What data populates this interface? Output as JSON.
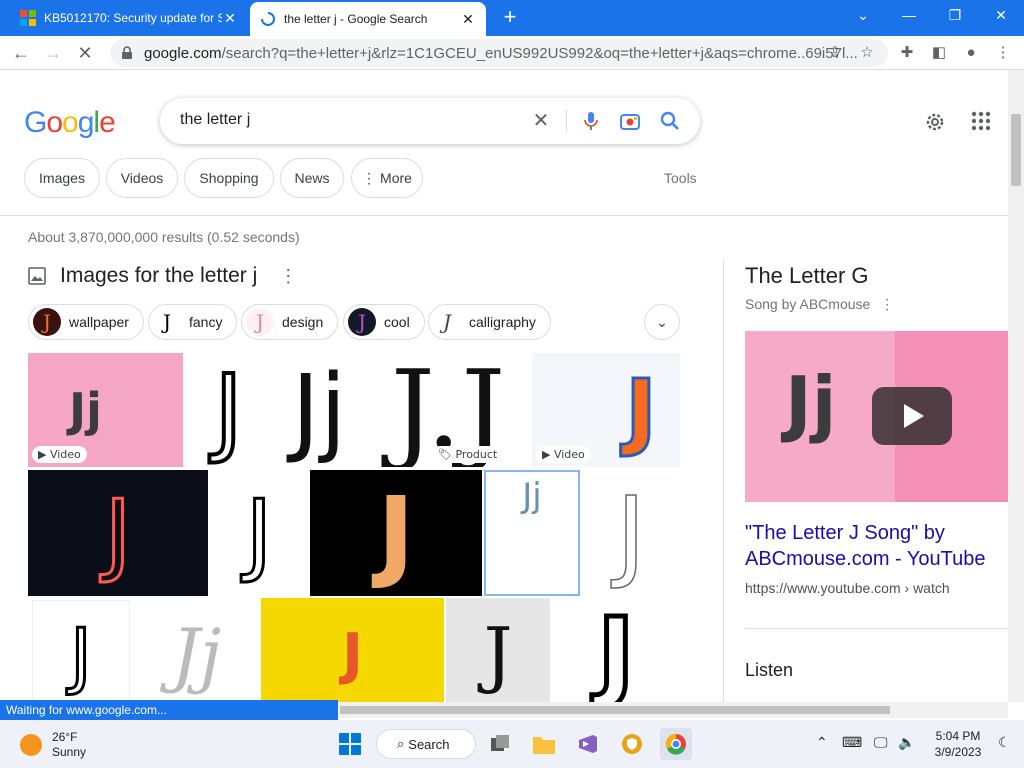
{
  "tabs": [
    {
      "title": "KB5012170: Security update for S",
      "close": "✕"
    },
    {
      "title": "the letter j - Google Search",
      "close": "✕"
    }
  ],
  "new_tab": "+",
  "window_controls": {
    "minimize": "—",
    "maximize": "❐",
    "close": "✕",
    "tabsearch": "⌄"
  },
  "address": {
    "domain": "google.com",
    "path": "/search?q=the+letter+j&rlz=1C1GCEU_enUS992US992&oq=the+letter+j&aqs=chrome..69i57l..."
  },
  "search": {
    "query": "the letter j"
  },
  "filters": [
    "Images",
    "Videos",
    "Shopping",
    "News",
    "More"
  ],
  "tools_label": "Tools",
  "results_stats": "About 3,870,000,000 results (0.52 seconds)",
  "images_section": {
    "title": "Images for the letter j",
    "pills": [
      "wallpaper",
      "fancy",
      "design",
      "cool",
      "calligraphy"
    ],
    "tags": {
      "video1": "Video",
      "product": "Product",
      "video2": "Video"
    }
  },
  "knowledge_panel": {
    "title": "The Letter G",
    "subtitle": "Song by ABCmouse",
    "link": "\"The Letter J Song\" by ABCmouse.com - YouTube",
    "url": "https://www.youtube.com › watch",
    "listen": "Listen"
  },
  "status_text": "Waiting for www.google.com...",
  "taskbar": {
    "weather_temp": "26°F",
    "weather_cond": "Sunny",
    "search_label": "Search",
    "time": "5:04 PM",
    "date": "3/9/2023"
  },
  "colors": {
    "accent": "#1a73e8",
    "link": "#1a0dab"
  }
}
